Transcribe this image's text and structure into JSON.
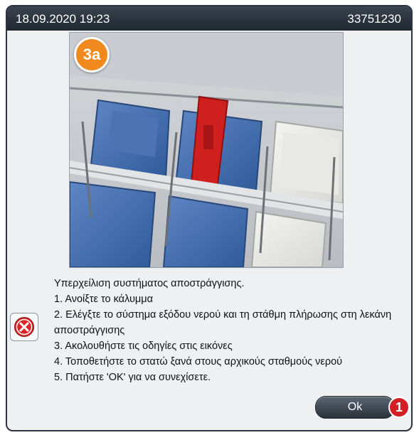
{
  "header": {
    "datetime": "18.09.2020 19:23",
    "device_id": "33751230"
  },
  "illustration": {
    "step_label": "3a"
  },
  "message": {
    "title": "Υπερχείλιση συστήματος αποστράγγισης.",
    "lines": [
      "1. Ανοίξτε το κάλυμμα",
      "2. Ελέγξτε το σύστημα εξόδου νερού και τη στάθμη πλήρωσης στη λεκάνη αποστράγγισης",
      "3. Ακολουθήστε τις οδηγίες στις εικόνες",
      "4. Τοποθετήστε το στατώ ξανά στους αρχικούς σταθμούς νερού",
      "5. Πατήστε 'ΟΚ' για να συνεχίσετε."
    ]
  },
  "buttons": {
    "ok_label": "Ok"
  },
  "callout": {
    "number": "1"
  },
  "icons": {
    "message_icon": "error-icon",
    "colors": {
      "error": "#d9262b",
      "badge_orange": "#f08a1e",
      "callout_red": "#d21f25",
      "titlebar": "#2b3440"
    }
  }
}
